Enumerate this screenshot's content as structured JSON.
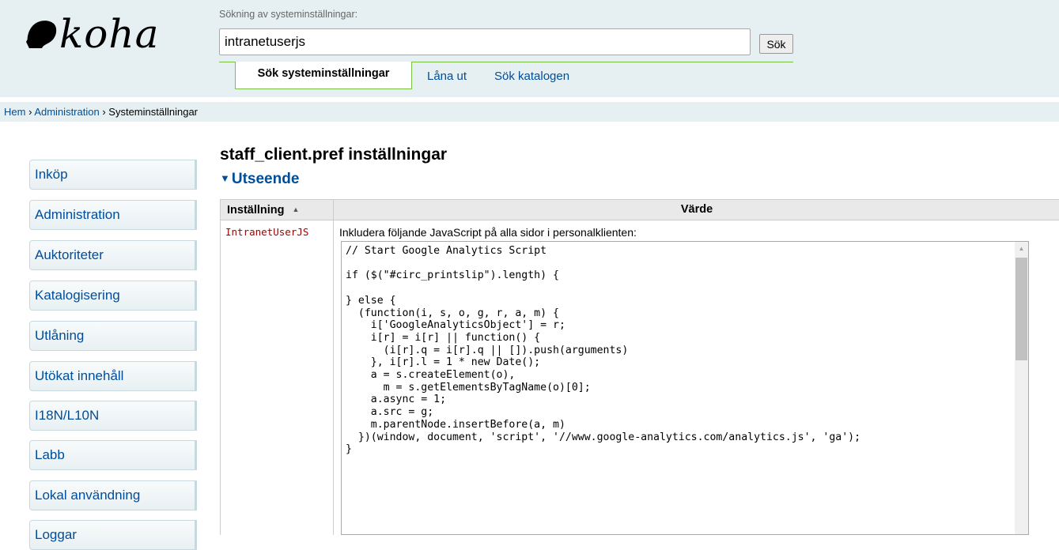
{
  "header": {
    "logo_text": "koha",
    "search_label": "Sökning av systeminställningar:",
    "search_value": "intranetuserjs",
    "search_button": "Sök",
    "tabs": [
      {
        "label": "Sök systeminställningar"
      },
      {
        "label": "Låna ut"
      },
      {
        "label": "Sök katalogen"
      }
    ]
  },
  "breadcrumbs": [
    {
      "label": "Hem"
    },
    {
      "label": "Administration"
    },
    {
      "label": "Systeminställningar"
    }
  ],
  "breadcrumb_separator": "›",
  "sidebar": {
    "items": [
      {
        "label": "Inköp"
      },
      {
        "label": "Administration"
      },
      {
        "label": "Auktoriteter"
      },
      {
        "label": "Katalogisering"
      },
      {
        "label": "Utlåning"
      },
      {
        "label": "Utökat innehåll"
      },
      {
        "label": "I18N/L10N"
      },
      {
        "label": "Labb"
      },
      {
        "label": "Lokal användning"
      },
      {
        "label": "Loggar"
      }
    ]
  },
  "main": {
    "title": "staff_client.pref inställningar",
    "section": "Utseende",
    "table": {
      "col_setting": "Inställning",
      "col_value": "Värde",
      "row": {
        "setting": "IntranetUserJS",
        "description": "Inkludera följande JavaScript på alla sidor i personalklienten:",
        "code": "// Start Google Analytics Script\n\nif ($(\"#circ_printslip\").length) {\n\n} else {\n  (function(i, s, o, g, r, a, m) {\n    i['GoogleAnalyticsObject'] = r;\n    i[r] = i[r] || function() {\n      (i[r].q = i[r].q || []).push(arguments)\n    }, i[r].l = 1 * new Date();\n    a = s.createElement(o),\n      m = s.getElementsByTagName(o)[0];\n    a.async = 1;\n    a.src = g;\n    m.parentNode.insertBefore(a, m)\n  })(window, document, 'script', '//www.google-analytics.com/analytics.js', 'ga');\n}"
      }
    }
  },
  "icons": {
    "logo": "koha-head-logo-icon",
    "section_toggle": "triangle-down-icon",
    "sort": "sort-ascending-icon",
    "scroll_up": "scroll-up-arrow-icon"
  },
  "colors": {
    "header_bg": "#e6f0f2",
    "link": "#004d99",
    "tab_border": "#7ac143",
    "setting_name": "#990000"
  }
}
